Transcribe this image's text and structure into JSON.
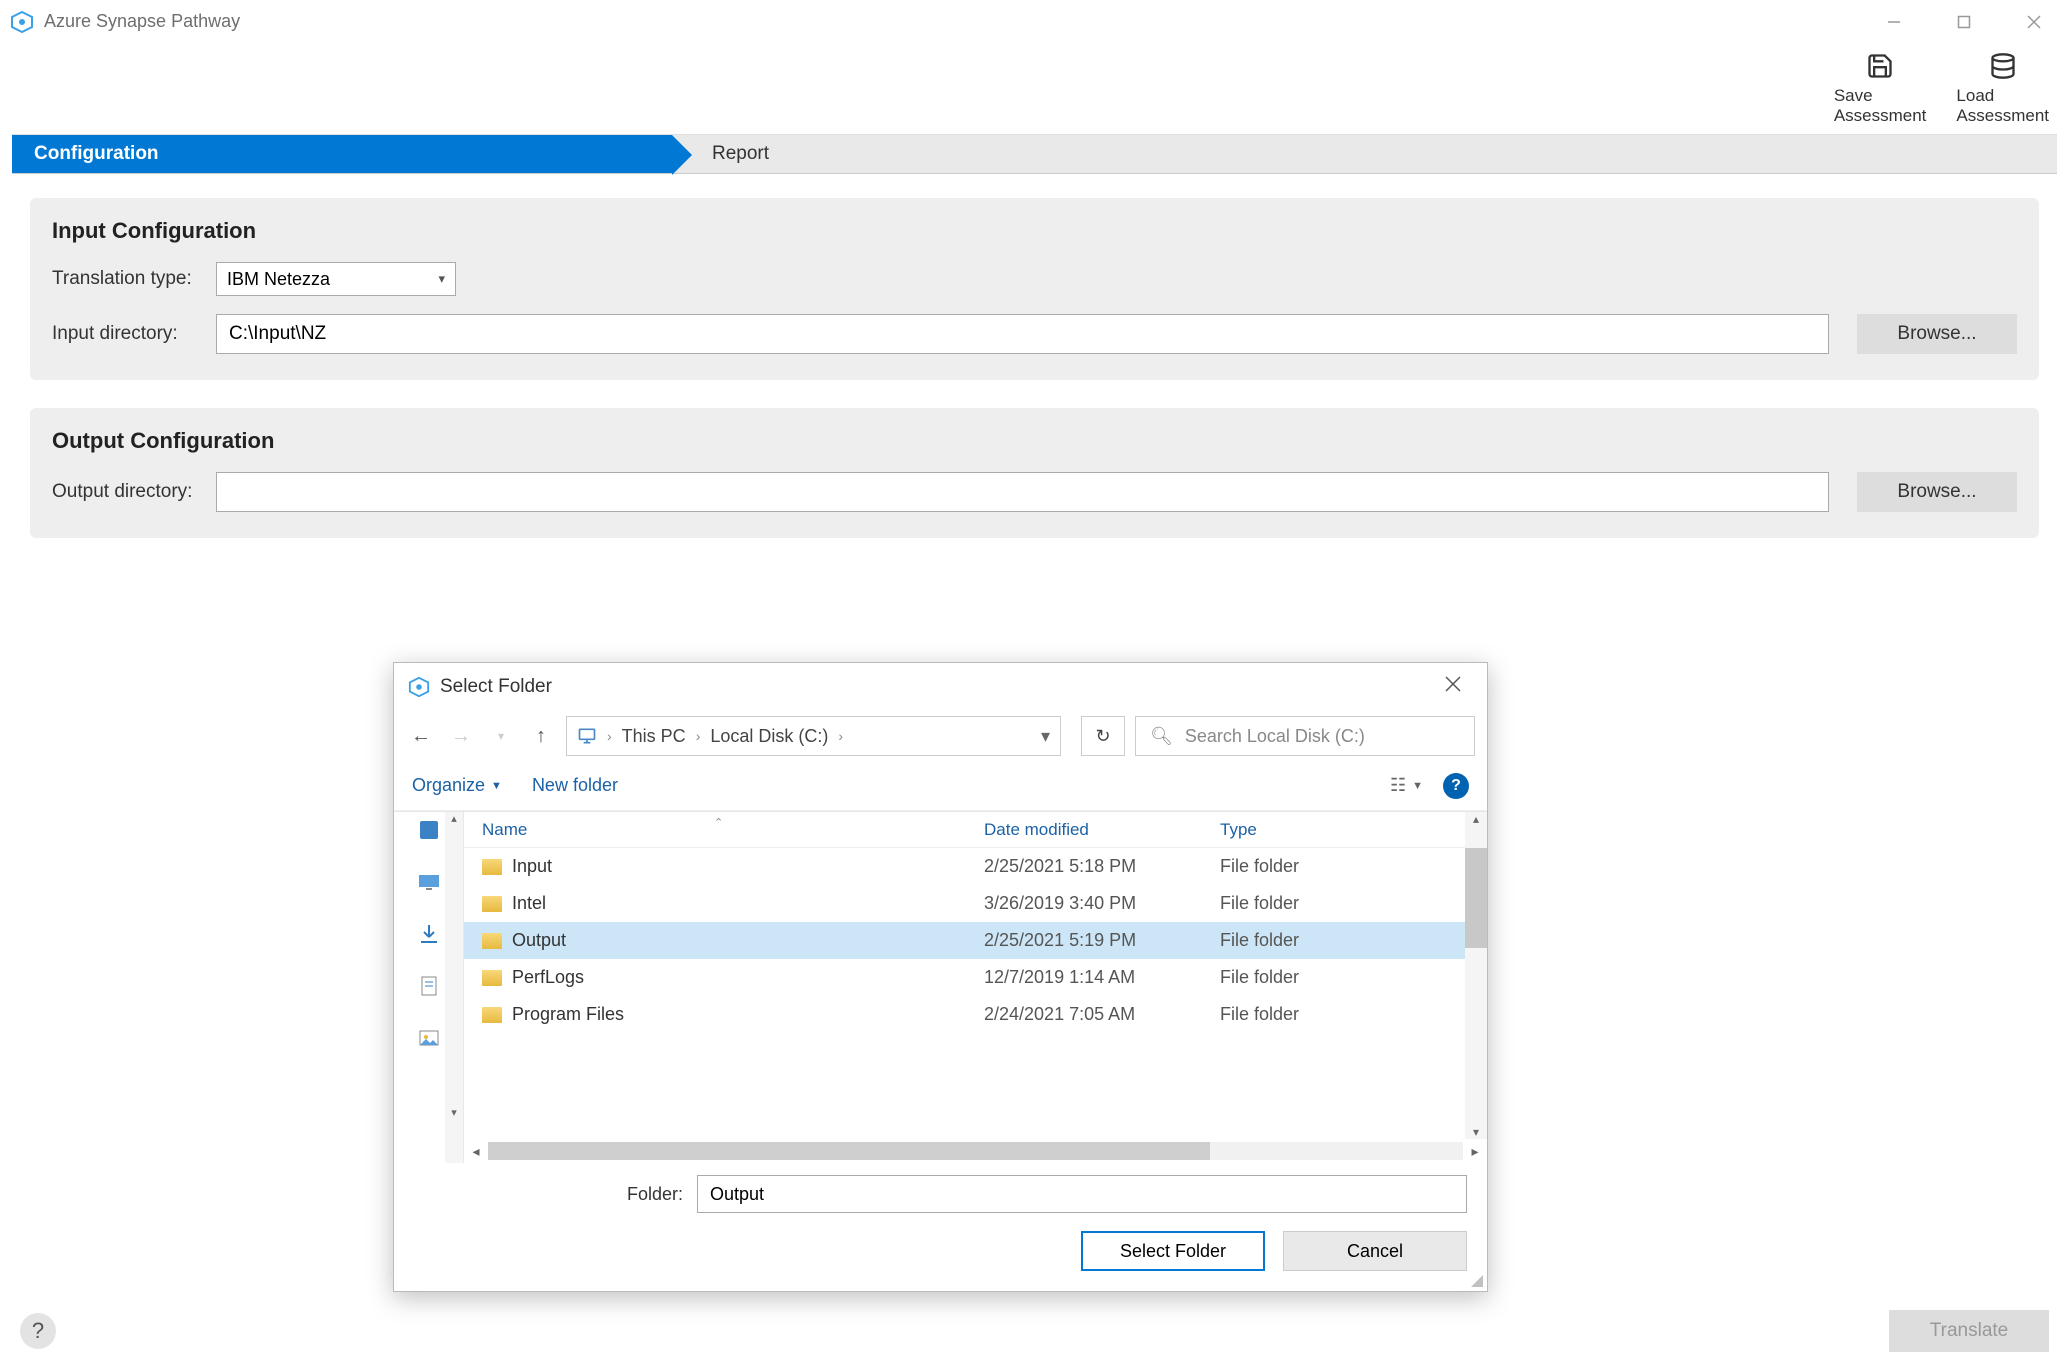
{
  "window": {
    "title": "Azure Synapse Pathway"
  },
  "toolbar": {
    "save": {
      "label": "Save",
      "sub": "Assessment"
    },
    "load": {
      "label": "Load",
      "sub": "Assessment"
    }
  },
  "tabs": {
    "configuration": "Configuration",
    "report": "Report"
  },
  "input_config": {
    "title": "Input Configuration",
    "translation_label": "Translation type:",
    "translation_value": "IBM Netezza",
    "dir_label": "Input directory:",
    "dir_value": "C:\\Input\\NZ",
    "browse": "Browse..."
  },
  "output_config": {
    "title": "Output Configuration",
    "dir_label": "Output directory:",
    "dir_value": "",
    "browse": "Browse..."
  },
  "footer": {
    "help": "?",
    "translate": "Translate"
  },
  "dialog": {
    "title": "Select Folder",
    "breadcrumb": {
      "root": "This PC",
      "drive": "Local Disk (C:)"
    },
    "search_placeholder": "Search Local Disk (C:)",
    "organize": "Organize",
    "new_folder": "New folder",
    "columns": {
      "name": "Name",
      "date": "Date modified",
      "type": "Type"
    },
    "rows": [
      {
        "name": "Input",
        "date": "2/25/2021 5:18 PM",
        "type": "File folder",
        "selected": false
      },
      {
        "name": "Intel",
        "date": "3/26/2019 3:40 PM",
        "type": "File folder",
        "selected": false
      },
      {
        "name": "Output",
        "date": "2/25/2021 5:19 PM",
        "type": "File folder",
        "selected": true
      },
      {
        "name": "PerfLogs",
        "date": "12/7/2019 1:14 AM",
        "type": "File folder",
        "selected": false
      },
      {
        "name": "Program Files",
        "date": "2/24/2021 7:05 AM",
        "type": "File folder",
        "selected": false
      }
    ],
    "folder_label": "Folder:",
    "folder_value": "Output",
    "select_btn": "Select Folder",
    "cancel_btn": "Cancel"
  }
}
